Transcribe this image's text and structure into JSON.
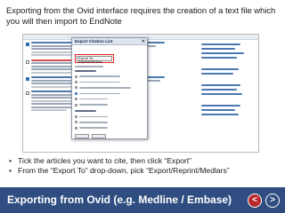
{
  "intro_text": "Exporting from the Ovid interface requires the creation of a text file which you will then import to EndNote",
  "dialog": {
    "title": "Export Citation List",
    "close_icon": "close-icon",
    "export_label": "Export To:",
    "export_value": "Export To: Reprint/Medlars"
  },
  "bullets": [
    "Tick the articles you want to cite, then click “Export”",
    "From the “Export To” drop-down, pick “Export/Reprint/Medlars”"
  ],
  "footer": {
    "title": "Exporting from Ovid (e.g. Medline / Embase)",
    "prev_label": "<",
    "next_label": ">",
    "prev_icon": "chevron-left-icon",
    "next_icon": "chevron-right-icon",
    "background": "#2f4d80",
    "prev_color": "#b8292b"
  },
  "colors": {
    "highlight_box": "#e02020",
    "link": "#4a77ae"
  }
}
